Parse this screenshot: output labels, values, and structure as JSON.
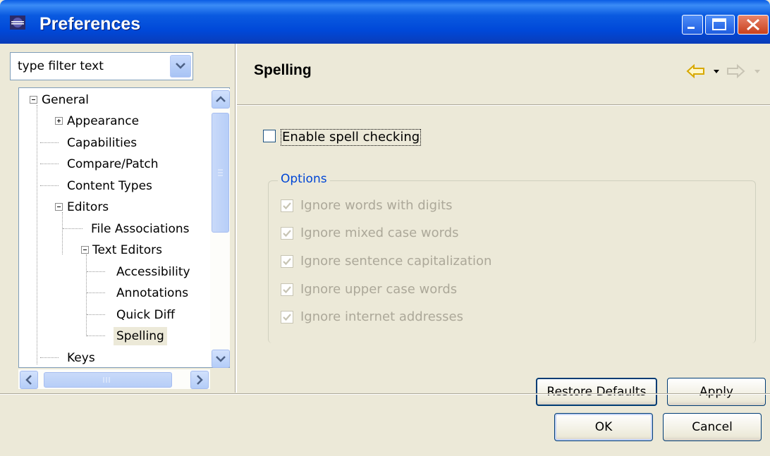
{
  "window": {
    "title": "Preferences"
  },
  "filter": {
    "placeholder": "type filter text",
    "value": "type filter text"
  },
  "tree": {
    "items": [
      {
        "label": "General"
      },
      {
        "label": "Appearance"
      },
      {
        "label": "Capabilities"
      },
      {
        "label": "Compare/Patch"
      },
      {
        "label": "Content Types"
      },
      {
        "label": "Editors"
      },
      {
        "label": "File Associations"
      },
      {
        "label": "Text Editors"
      },
      {
        "label": "Accessibility"
      },
      {
        "label": "Annotations"
      },
      {
        "label": "Quick Diff"
      },
      {
        "label": "Spelling"
      },
      {
        "label": "Keys"
      }
    ],
    "selected": "Spelling"
  },
  "page": {
    "title": "Spelling",
    "enable_label": "Enable spell checking",
    "enable_checked": false,
    "options_group": "Options",
    "options": [
      {
        "label": "Ignore words with digits",
        "checked": true
      },
      {
        "label": "Ignore mixed case words",
        "checked": true
      },
      {
        "label": "Ignore sentence capitalization",
        "checked": true
      },
      {
        "label": "Ignore upper case words",
        "checked": true
      },
      {
        "label": "Ignore internet addresses",
        "checked": true
      }
    ]
  },
  "buttons": {
    "restore_defaults": "Restore Defaults",
    "apply": "Apply",
    "ok": "OK",
    "cancel": "Cancel"
  },
  "colors": {
    "titlebar": "#0054e3",
    "window_bg": "#ece9d8",
    "group_label": "#0046d5",
    "disabled_text": "#aca899"
  }
}
